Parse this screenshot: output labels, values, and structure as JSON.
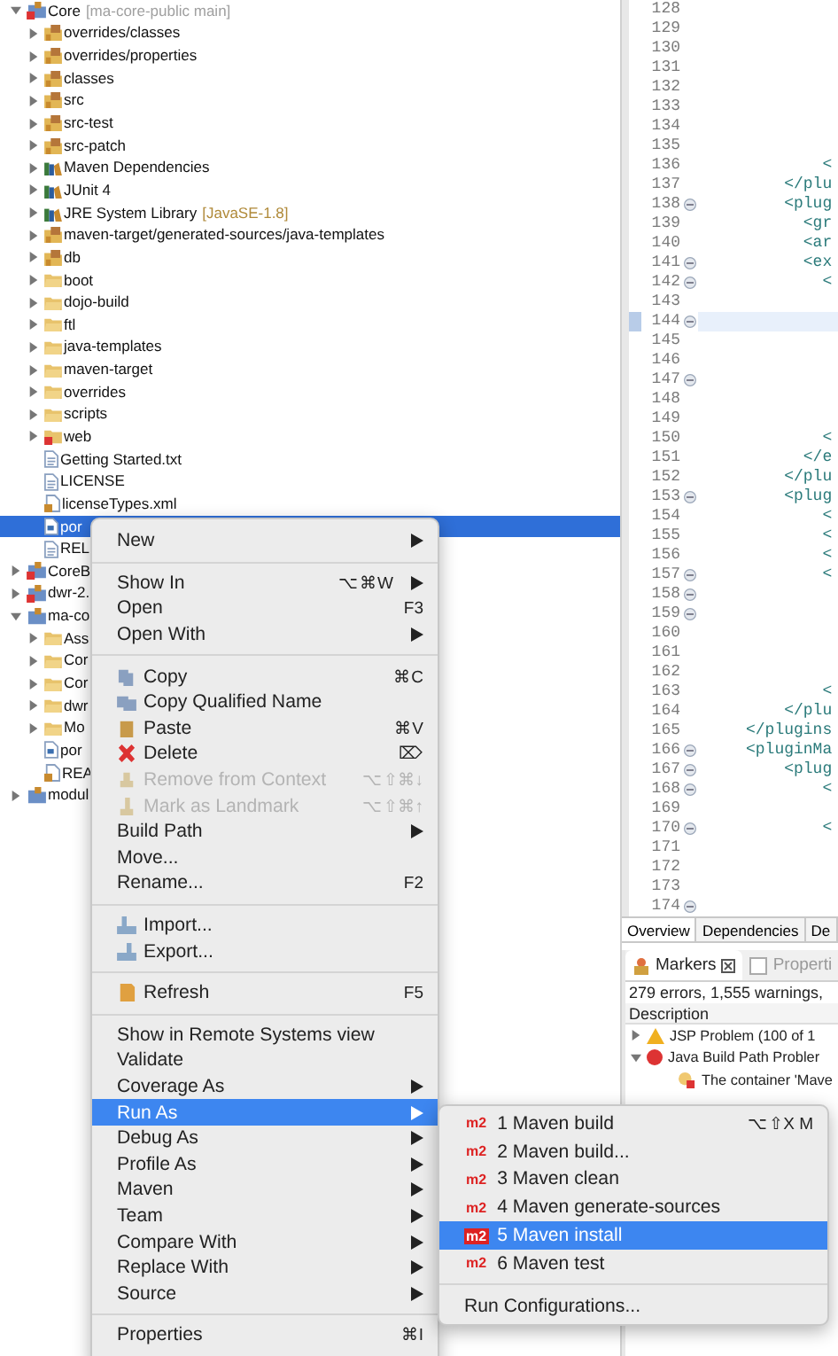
{
  "tree": [
    {
      "label": "Core",
      "suffix": "[ma-core-public main]",
      "kind": "project-error",
      "expanded": true,
      "selected": false,
      "children": [
        {
          "label": "overrides/classes",
          "kind": "package",
          "expanded": false,
          "selected": false
        },
        {
          "label": "overrides/properties",
          "kind": "package",
          "expanded": false,
          "selected": false
        },
        {
          "label": "classes",
          "kind": "package",
          "expanded": false,
          "selected": false
        },
        {
          "label": "src",
          "kind": "package",
          "expanded": false,
          "selected": false
        },
        {
          "label": "src-test",
          "kind": "package",
          "expanded": false,
          "selected": false
        },
        {
          "label": "src-patch",
          "kind": "package",
          "expanded": false,
          "selected": false
        },
        {
          "label": "Maven Dependencies",
          "kind": "library",
          "expanded": false,
          "selected": false
        },
        {
          "label": "JUnit 4",
          "kind": "library",
          "expanded": false,
          "selected": false
        },
        {
          "label": "JRE System Library",
          "suffix": "[JavaSE-1.8]",
          "kind": "library",
          "expanded": false,
          "selected": false
        },
        {
          "label": "maven-target/generated-sources/java-templates",
          "kind": "package",
          "expanded": false,
          "selected": false
        },
        {
          "label": "db",
          "kind": "package",
          "expanded": false,
          "selected": false
        },
        {
          "label": "boot",
          "kind": "folder",
          "expanded": false,
          "selected": false
        },
        {
          "label": "dojo-build",
          "kind": "folder",
          "expanded": false,
          "selected": false
        },
        {
          "label": "ftl",
          "kind": "folder",
          "expanded": false,
          "selected": false
        },
        {
          "label": "java-templates",
          "kind": "folder",
          "expanded": false,
          "selected": false
        },
        {
          "label": "maven-target",
          "kind": "folder",
          "expanded": false,
          "selected": false
        },
        {
          "label": "overrides",
          "kind": "folder",
          "expanded": false,
          "selected": false
        },
        {
          "label": "scripts",
          "kind": "folder",
          "expanded": false,
          "selected": false
        },
        {
          "label": "web",
          "kind": "folder-error",
          "expanded": false,
          "selected": false
        },
        {
          "label": "Getting Started.txt",
          "kind": "file",
          "selected": false
        },
        {
          "label": "LICENSE",
          "kind": "file",
          "selected": false
        },
        {
          "label": "licenseTypes.xml",
          "kind": "xml",
          "selected": false
        },
        {
          "label": "por",
          "kind": "pom",
          "selected": true
        },
        {
          "label": "REL",
          "kind": "file",
          "selected": false
        }
      ]
    },
    {
      "label": "CoreB",
      "kind": "project-error",
      "expanded": false,
      "selected": false
    },
    {
      "label": "dwr-2.",
      "kind": "project-error",
      "expanded": false,
      "selected": false
    },
    {
      "label": "ma-co",
      "kind": "project",
      "expanded": true,
      "selected": false,
      "children": [
        {
          "label": "Ass",
          "kind": "folder",
          "expanded": false,
          "selected": false
        },
        {
          "label": "Cor",
          "kind": "folder",
          "expanded": false,
          "selected": false
        },
        {
          "label": "Cor",
          "kind": "folder",
          "expanded": false,
          "selected": false
        },
        {
          "label": "dwr",
          "kind": "folder",
          "expanded": false,
          "selected": false
        },
        {
          "label": "Mo",
          "kind": "folder",
          "expanded": false,
          "selected": false
        },
        {
          "label": "por",
          "kind": "pom",
          "selected": false
        },
        {
          "label": "REA",
          "kind": "xml",
          "selected": false
        }
      ]
    },
    {
      "label": "modul",
      "kind": "project",
      "expanded": false,
      "selected": false
    }
  ],
  "context_menu": [
    {
      "kind": "item",
      "label": "New",
      "submenu": true,
      "disabled": false,
      "selected": false
    },
    {
      "kind": "separator"
    },
    {
      "kind": "item",
      "label": "Show In",
      "shortcut": "⌥⌘W",
      "submenu": true,
      "disabled": false,
      "selected": false
    },
    {
      "kind": "item",
      "label": "Open",
      "shortcut": "F3",
      "submenu": false,
      "disabled": false,
      "selected": false
    },
    {
      "kind": "item",
      "label": "Open With",
      "submenu": true,
      "disabled": false,
      "selected": false
    },
    {
      "kind": "separator"
    },
    {
      "kind": "item",
      "label": "Copy",
      "shortcut": "⌘C",
      "submenu": false,
      "disabled": false,
      "selected": false
    },
    {
      "kind": "item",
      "label": "Copy Qualified Name",
      "submenu": false,
      "disabled": false,
      "selected": false
    },
    {
      "kind": "item",
      "label": "Paste",
      "shortcut": "⌘V",
      "submenu": false,
      "disabled": false,
      "selected": false
    },
    {
      "kind": "item",
      "label": "Delete",
      "shortcut": "⌦",
      "submenu": false,
      "disabled": false,
      "selected": false
    },
    {
      "kind": "item",
      "label": "Remove from Context",
      "shortcut": "⌥⇧⌘↓",
      "submenu": false,
      "disabled": true,
      "selected": false
    },
    {
      "kind": "item",
      "label": "Mark as Landmark",
      "shortcut": "⌥⇧⌘↑",
      "submenu": false,
      "disabled": true,
      "selected": false
    },
    {
      "kind": "item",
      "label": "Build Path",
      "submenu": true,
      "disabled": false,
      "selected": false
    },
    {
      "kind": "item",
      "label": "Move...",
      "submenu": false,
      "disabled": false,
      "selected": false
    },
    {
      "kind": "item",
      "label": "Rename...",
      "shortcut": "F2",
      "submenu": false,
      "disabled": false,
      "selected": false
    },
    {
      "kind": "separator"
    },
    {
      "kind": "item",
      "label": "Import...",
      "submenu": false,
      "disabled": false,
      "selected": false
    },
    {
      "kind": "item",
      "label": "Export...",
      "submenu": false,
      "disabled": false,
      "selected": false
    },
    {
      "kind": "separator"
    },
    {
      "kind": "item",
      "label": "Refresh",
      "shortcut": "F5",
      "submenu": false,
      "disabled": false,
      "selected": false
    },
    {
      "kind": "separator"
    },
    {
      "kind": "item",
      "label": "Show in Remote Systems view",
      "submenu": false,
      "disabled": false,
      "selected": false
    },
    {
      "kind": "item",
      "label": "Validate",
      "submenu": false,
      "disabled": false,
      "selected": false
    },
    {
      "kind": "item",
      "label": "Coverage As",
      "submenu": true,
      "disabled": false,
      "selected": false
    },
    {
      "kind": "item",
      "label": "Run As",
      "submenu": true,
      "disabled": false,
      "selected": true
    },
    {
      "kind": "item",
      "label": "Debug As",
      "submenu": true,
      "disabled": false,
      "selected": false
    },
    {
      "kind": "item",
      "label": "Profile As",
      "submenu": true,
      "disabled": false,
      "selected": false
    },
    {
      "kind": "item",
      "label": "Maven",
      "submenu": true,
      "disabled": false,
      "selected": false
    },
    {
      "kind": "item",
      "label": "Team",
      "submenu": true,
      "disabled": false,
      "selected": false
    },
    {
      "kind": "item",
      "label": "Compare With",
      "submenu": true,
      "disabled": false,
      "selected": false
    },
    {
      "kind": "item",
      "label": "Replace With",
      "submenu": true,
      "disabled": false,
      "selected": false
    },
    {
      "kind": "item",
      "label": "Source",
      "submenu": true,
      "disabled": false,
      "selected": false
    },
    {
      "kind": "separator"
    },
    {
      "kind": "item",
      "label": "Properties",
      "shortcut": "⌘I",
      "submenu": false,
      "disabled": false,
      "selected": false
    }
  ],
  "run_as_menu": [
    {
      "kind": "item",
      "badge": "m2",
      "label": "1 Maven build",
      "shortcut": "⌥⇧X M",
      "selected": false
    },
    {
      "kind": "item",
      "badge": "m2",
      "label": "2 Maven build...",
      "selected": false
    },
    {
      "kind": "item",
      "badge": "m2",
      "label": "3 Maven clean",
      "selected": false
    },
    {
      "kind": "item",
      "badge": "m2",
      "label": "4 Maven generate-sources",
      "selected": false
    },
    {
      "kind": "item",
      "badge": "m2",
      "label": "5 Maven install",
      "selected": true
    },
    {
      "kind": "item",
      "badge": "m2",
      "label": "6 Maven test",
      "selected": false
    },
    {
      "kind": "separator"
    },
    {
      "kind": "item",
      "label": "Run Configurations...",
      "selected": false
    }
  ],
  "editor": {
    "lines": [
      {
        "number": "128",
        "fold": false,
        "current": false
      },
      {
        "number": "129",
        "fold": false,
        "current": false
      },
      {
        "number": "130",
        "fold": false,
        "current": false
      },
      {
        "number": "131",
        "fold": false,
        "current": false
      },
      {
        "number": "132",
        "fold": false,
        "current": false
      },
      {
        "number": "133",
        "fold": false,
        "current": false
      },
      {
        "number": "134",
        "fold": false,
        "current": false
      },
      {
        "number": "135",
        "fold": false,
        "current": false
      },
      {
        "number": "136",
        "code": "             <",
        "fold": false,
        "current": false
      },
      {
        "number": "137",
        "code": "         </plu",
        "fold": false,
        "current": false
      },
      {
        "number": "138",
        "code": "         <plug",
        "fold": true,
        "current": false
      },
      {
        "number": "139",
        "code": "           <gr",
        "fold": false,
        "current": false
      },
      {
        "number": "140",
        "code": "           <ar",
        "fold": false,
        "current": false
      },
      {
        "number": "141",
        "code": "           <ex",
        "fold": true,
        "current": false
      },
      {
        "number": "142",
        "code": "             <",
        "fold": true,
        "current": false
      },
      {
        "number": "143",
        "fold": false,
        "current": false
      },
      {
        "number": "144",
        "fold": true,
        "current": true
      },
      {
        "number": "145",
        "fold": false,
        "current": false
      },
      {
        "number": "146",
        "fold": false,
        "current": false
      },
      {
        "number": "147",
        "fold": true,
        "current": false
      },
      {
        "number": "148",
        "fold": false,
        "current": false
      },
      {
        "number": "149",
        "fold": false,
        "current": false
      },
      {
        "number": "150",
        "code": "             <",
        "fold": false,
        "current": false
      },
      {
        "number": "151",
        "code": "           </e",
        "fold": false,
        "current": false
      },
      {
        "number": "152",
        "code": "         </plu",
        "fold": false,
        "current": false
      },
      {
        "number": "153",
        "code": "         <plug",
        "fold": true,
        "current": false
      },
      {
        "number": "154",
        "code": "             <",
        "fold": false,
        "current": false
      },
      {
        "number": "155",
        "code": "             <",
        "fold": false,
        "current": false
      },
      {
        "number": "156",
        "code": "             <",
        "fold": false,
        "current": false
      },
      {
        "number": "157",
        "code": "             <",
        "fold": true,
        "current": false
      },
      {
        "number": "158",
        "fold": true,
        "current": false
      },
      {
        "number": "159",
        "fold": true,
        "current": false
      },
      {
        "number": "160",
        "fold": false,
        "current": false
      },
      {
        "number": "161",
        "fold": false,
        "current": false
      },
      {
        "number": "162",
        "fold": false,
        "current": false
      },
      {
        "number": "163",
        "code": "             <",
        "fold": false,
        "current": false
      },
      {
        "number": "164",
        "code": "         </plu",
        "fold": false,
        "current": false
      },
      {
        "number": "165",
        "code": "     </plugins",
        "fold": false,
        "current": false
      },
      {
        "number": "166",
        "code": "     <pluginMa",
        "fold": true,
        "current": false
      },
      {
        "number": "167",
        "code": "         <plug",
        "fold": true,
        "current": false
      },
      {
        "number": "168",
        "code": "             <",
        "fold": true,
        "current": false
      },
      {
        "number": "169",
        "fold": false,
        "current": false
      },
      {
        "number": "170",
        "code": "             <",
        "fold": true,
        "current": false
      },
      {
        "number": "171",
        "fold": false,
        "current": false
      },
      {
        "number": "172",
        "fold": false,
        "current": false
      },
      {
        "number": "173",
        "fold": false,
        "current": false
      },
      {
        "number": "174",
        "fold": true,
        "current": false
      }
    ],
    "tabs": [
      {
        "label": "Overview",
        "selected": true
      },
      {
        "label": "Dependencies",
        "selected": false
      },
      {
        "label": "De",
        "selected": false
      }
    ]
  },
  "markers": {
    "tabs": [
      {
        "label": "Markers",
        "selected": true
      },
      {
        "label": "Properti",
        "selected": false
      }
    ],
    "summary": "279 errors, 1,555 warnings,",
    "column": "Description",
    "rows": [
      {
        "label": "JSP Problem (100 of 1",
        "kind": "warning",
        "expanded": false
      },
      {
        "label": "Java Build Path Probler",
        "kind": "error",
        "expanded": true,
        "children": [
          {
            "label": "The container 'Mave",
            "kind": "error-item"
          }
        ]
      }
    ]
  }
}
